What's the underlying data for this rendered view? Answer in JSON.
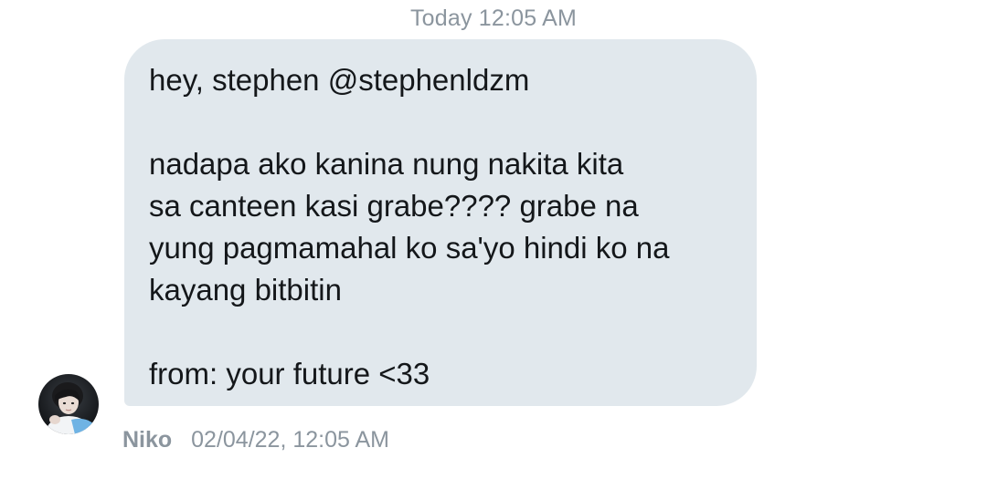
{
  "conversation": {
    "day_stamp": "Today 12:05 AM",
    "message": {
      "lines": [
        "hey, stephen @stephenldzm",
        "",
        "nadapa ako kanina nung nakita kita",
        "sa canteen kasi grabe???? grabe na",
        "yung pagmamahal ko sa'yo hindi ko na",
        "kayang bitbitin",
        "",
        "from: your future <33"
      ],
      "sender": "Niko",
      "timestamp": "02/04/22, 12:05 AM"
    }
  },
  "colors": {
    "bubble": "#e1e8ed",
    "text": "#14171a",
    "meta": "#8b959e"
  },
  "icons": {
    "avatar": "profile-photo"
  }
}
